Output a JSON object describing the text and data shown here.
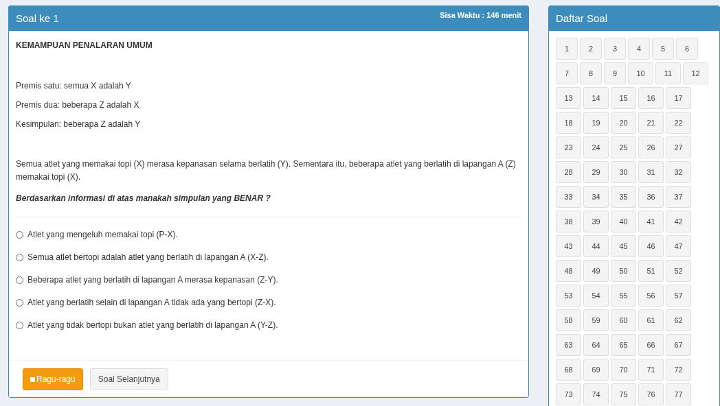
{
  "question_panel": {
    "title": "Soal ke 1",
    "timer": "Sisa Waktu : 146 menit",
    "section": "KEMAMPUAN PENALARAN UMUM",
    "premises": [
      "Premis satu: semua X adalah Y",
      "Premis dua: beberapa Z adalah X",
      "Kesimpulan: beberapa Z adalah Y"
    ],
    "passage": "Semua atlet yang memakai topi (X) merasa kepanasan selama berlatih (Y). Sementara itu, beberapa atlet yang berlatih di lapangan A (Z) memakai topi (X).",
    "question": "Berdasarkan informasi di atas manakah simpulan yang BENAR ?",
    "options": [
      {
        "label": "Atlet yang mengeluh memakai topi (P-X).",
        "selected": false
      },
      {
        "label": "Semua atlet bertopi adalah atlet yang berlatih di lapangan A (X-Z).",
        "selected": false
      },
      {
        "label": "Beberapa atlet yang berlatih di lapangan A merasa kepanasan (Z-Y).",
        "selected": false
      },
      {
        "label": "Atlet yang berlatih selain di lapangan A tidak ada yang bertopi (Z-X).",
        "selected": false
      },
      {
        "label": "Atlet yang tidak bertopi bukan atlet yang berlatih di lapangan A (Y-Z).",
        "selected": false
      }
    ],
    "doubt_button": {
      "label": "Ragu-ragu",
      "checked": false
    },
    "next_button": "Soal Selanjutnya"
  },
  "question_list": {
    "title": "Daftar Soal",
    "numbers": [
      "1",
      "2",
      "3",
      "4",
      "5",
      "6",
      "7",
      "8",
      "9",
      "10",
      "11",
      "12",
      "13",
      "14",
      "15",
      "16",
      "17",
      "18",
      "19",
      "20",
      "21",
      "22",
      "23",
      "24",
      "25",
      "26",
      "27",
      "28",
      "29",
      "30",
      "31",
      "32",
      "33",
      "34",
      "35",
      "36",
      "37",
      "38",
      "39",
      "40",
      "41",
      "42",
      "43",
      "44",
      "45",
      "46",
      "47",
      "48",
      "49",
      "50",
      "51",
      "52",
      "53",
      "54",
      "55",
      "56",
      "57",
      "58",
      "59",
      "60",
      "61",
      "62",
      "63",
      "64",
      "65",
      "66",
      "67",
      "68",
      "69",
      "70",
      "71",
      "72",
      "73",
      "74",
      "75",
      "76",
      "77"
    ]
  }
}
